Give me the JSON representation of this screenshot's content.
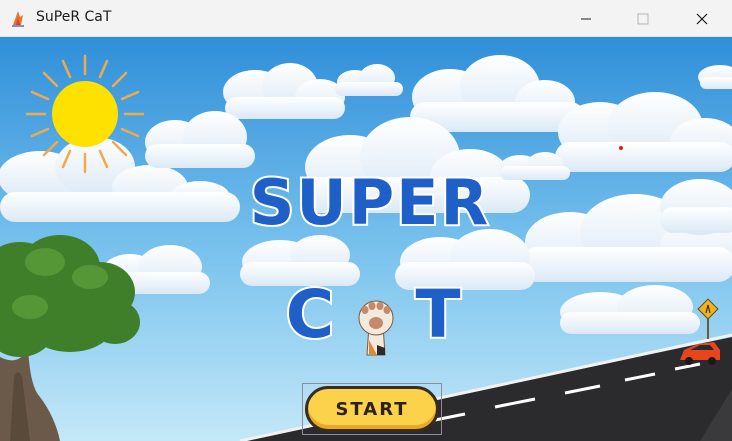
{
  "window": {
    "title": "SuPeR CaT",
    "icon": "app-icon",
    "controls": [
      "minimize-icon",
      "maximize-icon",
      "close-icon"
    ]
  },
  "game": {
    "logo_line1": "SUPER",
    "logo_line2_left": "C",
    "logo_line2_right": "T",
    "logo_middle_icon": "cat-paw-icon",
    "start_label": "START"
  },
  "colors": {
    "sky_top": "#2f8fd9",
    "sky_bottom": "#bfe6f7",
    "logo_blue": "#1f5fc8",
    "start_yellow": "#fdd24b",
    "road": "#2b2b2d",
    "sun": "#ffe100"
  },
  "scene_elements": [
    "sun",
    "clouds",
    "tree",
    "road",
    "car",
    "warning-sign"
  ]
}
